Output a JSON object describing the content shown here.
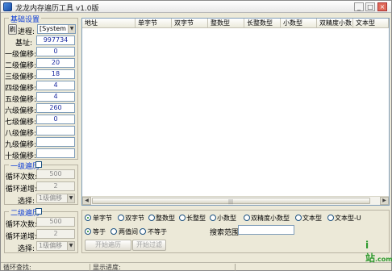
{
  "window": {
    "title": "龙龙内存遍历工具 v1.0版"
  },
  "base": {
    "legend": "基础设置",
    "refresh_label": "刷",
    "process_label": "进程:",
    "process_value": "[System Pr...",
    "base_label": "基址:",
    "base_value": "997734",
    "offsets": [
      {
        "label": "一级偏移:",
        "value": "0"
      },
      {
        "label": "二级偏移:",
        "value": "20"
      },
      {
        "label": "三级偏移:",
        "value": "18"
      },
      {
        "label": "四级偏移:",
        "value": "4"
      },
      {
        "label": "五级偏移:",
        "value": "4"
      },
      {
        "label": "六级偏移:",
        "value": "260"
      },
      {
        "label": "七级偏移:",
        "value": "0"
      },
      {
        "label": "八级偏移:",
        "value": ""
      },
      {
        "label": "九级偏移:",
        "value": ""
      },
      {
        "label": "十级偏移:",
        "value": ""
      }
    ]
  },
  "traverse1": {
    "legend": "一级遍历",
    "count_label": "循环次数:",
    "count_value": "500",
    "inc_label": "循环递增:",
    "inc_value": "2",
    "sel_label": "选择:",
    "sel_value": "1级偏移"
  },
  "traverse2": {
    "legend": "二级遍历",
    "count_label": "循环次数:",
    "count_value": "500",
    "inc_label": "循环递增:",
    "inc_value": "2",
    "sel_label": "选择:",
    "sel_value": "1级偏移"
  },
  "table": {
    "columns": [
      "地址",
      "单字节",
      "双字节",
      "整数型",
      "长整数型",
      "小数型",
      "双精度小数",
      "文本型"
    ]
  },
  "types": {
    "options": [
      "单字节",
      "双字节",
      "整数型",
      "长整型",
      "小数型",
      "双精度小数型",
      "文本型",
      "文本型-U"
    ],
    "selected": 0
  },
  "compare": {
    "options": [
      "等于",
      "两值间",
      "不等于"
    ],
    "selected": 0,
    "range_label": "搜索范围:",
    "range_value": ""
  },
  "actions": {
    "start_label": "开始遍历",
    "filter_label": "开始过滤"
  },
  "status": {
    "left": "循环查找:",
    "right": "显示进度:"
  },
  "watermark": {
    "text": "i站",
    "sub": ".com"
  }
}
